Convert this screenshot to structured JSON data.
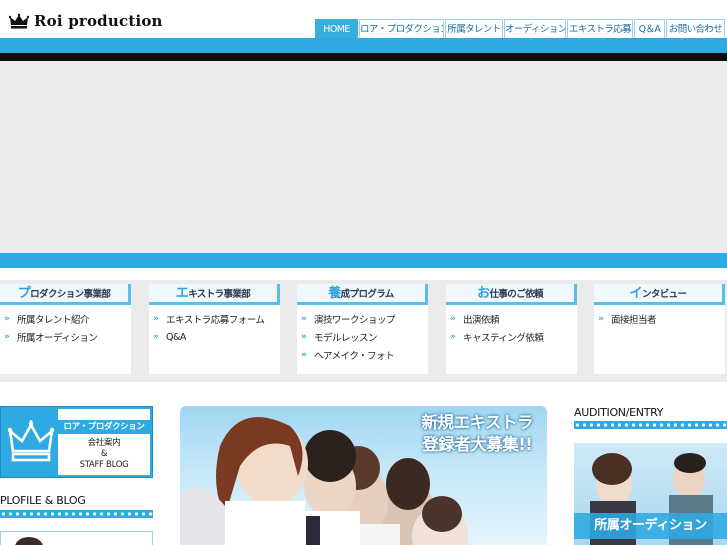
{
  "brand": {
    "logo_text": "Roi production",
    "logo_icon": "crown-icon"
  },
  "global_nav": [
    {
      "label": "HOME",
      "active": true
    },
    {
      "label": "ロア・プロダクション",
      "active": false
    },
    {
      "label": "所属タレント",
      "active": false
    },
    {
      "label": "オーディション",
      "active": false
    },
    {
      "label": "エキストラ応募",
      "active": false
    },
    {
      "label": "Q＆A",
      "active": false
    },
    {
      "label": "お問い合わせ",
      "active": false
    }
  ],
  "categories": [
    {
      "lead": "プ",
      "rest": "ロダクション事業部",
      "links": [
        "所属タレント紹介",
        "所属オーディション"
      ]
    },
    {
      "lead": "エ",
      "rest": "キストラ事業部",
      "links": [
        "エキストラ応募フォーム",
        "Q&A"
      ]
    },
    {
      "lead": "養",
      "rest": "成プログラム",
      "links": [
        "演技ワークショップ",
        "モデルレッスン",
        "ヘアメイク・フォト"
      ]
    },
    {
      "lead": "お",
      "rest": "仕事のご依頼",
      "links": [
        "出演依頼",
        "キャスティング依頼"
      ]
    },
    {
      "lead": "イ",
      "rest": "ンタビュー",
      "links": [
        "面接担当者"
      ]
    }
  ],
  "side_banner": {
    "title": "ロア・プロダクション",
    "line1": "会社案内",
    "line2": "&",
    "line3": "STAFF BLOG"
  },
  "sections": {
    "profile_blog": "PLOFILE & BLOG",
    "audition_entry": "AUDITION/ENTRY"
  },
  "main_banner": {
    "line1": "新規エキストラ",
    "line2": "登録者大募集!!"
  },
  "audition_banner": {
    "label": "所属オーディション"
  },
  "colors": {
    "accent_blue": "#2fa9e1",
    "nav_text": "#1b6ea0",
    "hero_gray": "#ebebeb",
    "black_bar": "#0d0d0d"
  }
}
